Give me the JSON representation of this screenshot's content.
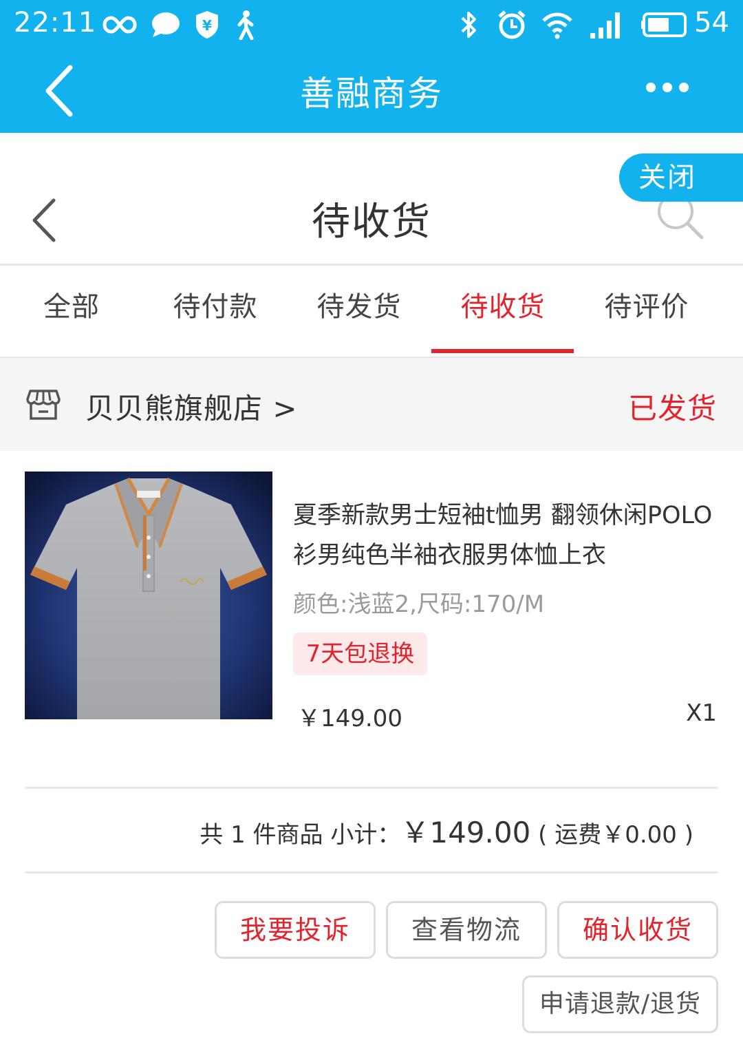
{
  "status_bar": {
    "time": "22:11",
    "battery": "54"
  },
  "app_bar": {
    "title": "善融商务"
  },
  "page_header": {
    "title": "待收货",
    "close_label": "关闭"
  },
  "tabs": [
    {
      "label": "全部",
      "active": false
    },
    {
      "label": "待付款",
      "active": false
    },
    {
      "label": "待发货",
      "active": false
    },
    {
      "label": "待收货",
      "active": true
    },
    {
      "label": "待评价",
      "active": false
    }
  ],
  "order": {
    "shop_name": "贝贝熊旗舰店 >",
    "status": "已发货",
    "product": {
      "title": "夏季新款男士短袖t恤男 翻领休闲POLO衫男纯色半袖衣服男体恤上衣",
      "spec": "颜色:浅蓝2,尺码:170/M",
      "badge": "7天包退换",
      "price": "￥149.00",
      "qty": "X1"
    },
    "summary": {
      "count_text": "共 1 件商品 小计：",
      "subtotal": "￥149.00",
      "shipping": "( 运费￥0.00 )"
    },
    "actions": {
      "complain": "我要投诉",
      "logistics": "查看物流",
      "confirm": "确认收货",
      "refund": "申请退款/退货"
    }
  },
  "colors": {
    "brand_blue": "#12b2ef",
    "accent_red": "#e4222c"
  },
  "icons": {
    "status_left": [
      "infinity-icon",
      "chat-bubble-icon",
      "shield-yuan-icon",
      "walking-person-icon"
    ],
    "status_right": [
      "bluetooth-icon",
      "alarm-clock-icon",
      "wifi-icon",
      "signal-icon",
      "battery-icon"
    ]
  }
}
